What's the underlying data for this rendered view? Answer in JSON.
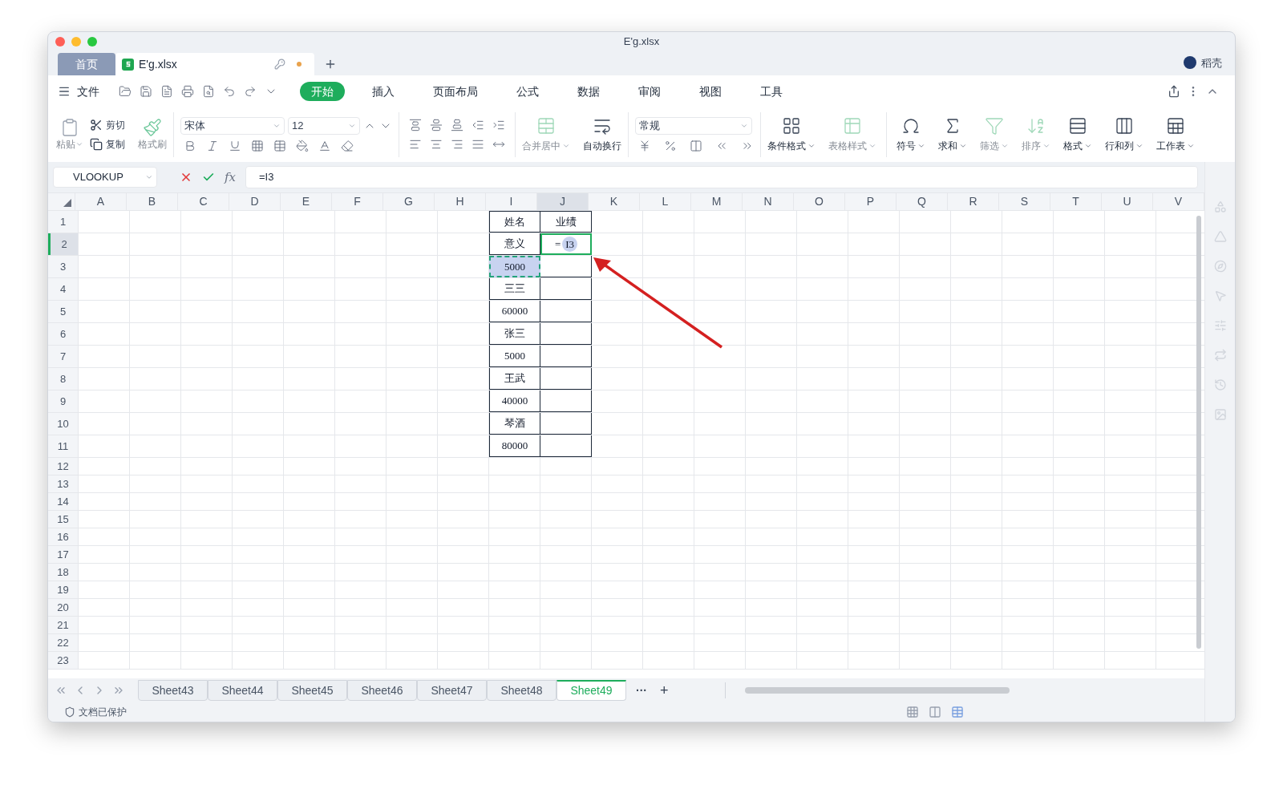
{
  "window": {
    "title": "E'g.xlsx"
  },
  "doc_tabs": [
    {
      "label": "首页",
      "selected": false,
      "kind": "home"
    },
    {
      "label": "E'g.xlsx",
      "selected": true,
      "kind": "file",
      "unsaved": true
    }
  ],
  "user": {
    "name": "稻壳"
  },
  "menu": {
    "file": "文件",
    "tabs": [
      {
        "label": "开始",
        "selected": true
      },
      {
        "label": "插入",
        "selected": false
      },
      {
        "label": "页面布局",
        "selected": false
      },
      {
        "label": "公式",
        "selected": false
      },
      {
        "label": "数据",
        "selected": false
      },
      {
        "label": "审阅",
        "selected": false
      },
      {
        "label": "视图",
        "selected": false
      },
      {
        "label": "工具",
        "selected": false
      }
    ]
  },
  "ribbon": {
    "paste": {
      "label": "粘贴",
      "disabled": true
    },
    "cut": "剪切",
    "copy": "复制",
    "format_painter": {
      "label": "格式刷",
      "disabled": true
    },
    "font_name": "宋体",
    "font_size": "12",
    "number_format": "常规",
    "buttons": [
      {
        "label": "合并居中",
        "disabled": true,
        "dropdown": true
      },
      {
        "label": "自动换行",
        "disabled": false,
        "dropdown": false
      },
      {
        "label": "条件格式",
        "disabled": false,
        "dropdown": true
      },
      {
        "label": "表格样式",
        "disabled": true,
        "dropdown": true
      },
      {
        "label": "符号",
        "disabled": false,
        "dropdown": true
      },
      {
        "label": "求和",
        "disabled": false,
        "dropdown": true
      },
      {
        "label": "筛选",
        "disabled": true,
        "dropdown": true
      },
      {
        "label": "排序",
        "disabled": true,
        "dropdown": true
      },
      {
        "label": "格式",
        "disabled": false,
        "dropdown": true
      },
      {
        "label": "行和列",
        "disabled": false,
        "dropdown": true
      },
      {
        "label": "工作表",
        "disabled": false,
        "dropdown": true
      }
    ]
  },
  "formula_bar": {
    "name_box": "VLOOKUP",
    "function_label": "fx",
    "formula": "=I3"
  },
  "sheet": {
    "columns": [
      {
        "label": "A",
        "selected": false
      },
      {
        "label": "B",
        "selected": false
      },
      {
        "label": "C",
        "selected": false
      },
      {
        "label": "D",
        "selected": false
      },
      {
        "label": "E",
        "selected": false
      },
      {
        "label": "F",
        "selected": false
      },
      {
        "label": "G",
        "selected": false
      },
      {
        "label": "H",
        "selected": false
      },
      {
        "label": "I",
        "selected": false
      },
      {
        "label": "J",
        "selected": true
      },
      {
        "label": "K",
        "selected": false
      },
      {
        "label": "L",
        "selected": false
      },
      {
        "label": "M",
        "selected": false
      },
      {
        "label": "N",
        "selected": false
      },
      {
        "label": "O",
        "selected": false
      },
      {
        "label": "P",
        "selected": false
      },
      {
        "label": "Q",
        "selected": false
      },
      {
        "label": "R",
        "selected": false
      },
      {
        "label": "S",
        "selected": false
      },
      {
        "label": "T",
        "selected": false
      },
      {
        "label": "U",
        "selected": false
      },
      {
        "label": "V",
        "selected": false
      }
    ],
    "rows": [
      {
        "label": "1",
        "selected": false
      },
      {
        "label": "2",
        "selected": true
      },
      {
        "label": "3",
        "selected": false
      },
      {
        "label": "4",
        "selected": false
      },
      {
        "label": "5",
        "selected": false
      },
      {
        "label": "6",
        "selected": false
      },
      {
        "label": "7",
        "selected": false
      },
      {
        "label": "8",
        "selected": false
      },
      {
        "label": "9",
        "selected": false
      },
      {
        "label": "10",
        "selected": false
      },
      {
        "label": "11",
        "selected": false
      },
      {
        "label": "12",
        "selected": false
      },
      {
        "label": "13",
        "selected": false
      },
      {
        "label": "14",
        "selected": false
      },
      {
        "label": "15",
        "selected": false
      },
      {
        "label": "16",
        "selected": false
      },
      {
        "label": "17",
        "selected": false
      },
      {
        "label": "18",
        "selected": false
      },
      {
        "label": "19",
        "selected": false
      },
      {
        "label": "20",
        "selected": false
      },
      {
        "label": "21",
        "selected": false
      },
      {
        "label": "22",
        "selected": false
      },
      {
        "label": "23",
        "selected": false
      }
    ],
    "table": [
      [
        {
          "text": "姓名",
          "selected": false,
          "referenced": false
        },
        {
          "text": "业绩",
          "selected": false,
          "referenced": false
        }
      ],
      [
        {
          "text": "意义",
          "selected": false,
          "referenced": false
        },
        {
          "kind": "formula",
          "text": "=",
          "ref": "I3",
          "selected": true,
          "referenced": false
        }
      ],
      [
        {
          "text": "5000",
          "selected": false,
          "referenced": true
        },
        {
          "selected": false,
          "referenced": false
        }
      ],
      [
        {
          "text": "三三",
          "selected": false,
          "referenced": false
        },
        {
          "selected": false,
          "referenced": false
        }
      ],
      [
        {
          "text": "60000",
          "selected": false,
          "referenced": false
        },
        {
          "selected": false,
          "referenced": false
        }
      ],
      [
        {
          "text": "张三",
          "selected": false,
          "referenced": false
        },
        {
          "selected": false,
          "referenced": false
        }
      ],
      [
        {
          "text": "5000",
          "selected": false,
          "referenced": false
        },
        {
          "selected": false,
          "referenced": false
        }
      ],
      [
        {
          "text": "王武",
          "selected": false,
          "referenced": false
        },
        {
          "selected": false,
          "referenced": false
        }
      ],
      [
        {
          "text": "40000",
          "selected": false,
          "referenced": false
        },
        {
          "selected": false,
          "referenced": false
        }
      ],
      [
        {
          "text": "琴酒",
          "selected": false,
          "referenced": false
        },
        {
          "selected": false,
          "referenced": false
        }
      ],
      [
        {
          "text": "80000",
          "selected": false,
          "referenced": false
        },
        {
          "selected": false,
          "referenced": false
        }
      ]
    ]
  },
  "sheet_tabs": [
    {
      "label": "Sheet43",
      "selected": false
    },
    {
      "label": "Sheet44",
      "selected": false
    },
    {
      "label": "Sheet45",
      "selected": false
    },
    {
      "label": "Sheet46",
      "selected": false
    },
    {
      "label": "Sheet47",
      "selected": false
    },
    {
      "label": "Sheet48",
      "selected": false
    },
    {
      "label": "Sheet49",
      "selected": true
    }
  ],
  "sheet_tabs_more": "···",
  "sheet_tabs_add": "+",
  "status_bar": {
    "protection": "文档已保护"
  }
}
